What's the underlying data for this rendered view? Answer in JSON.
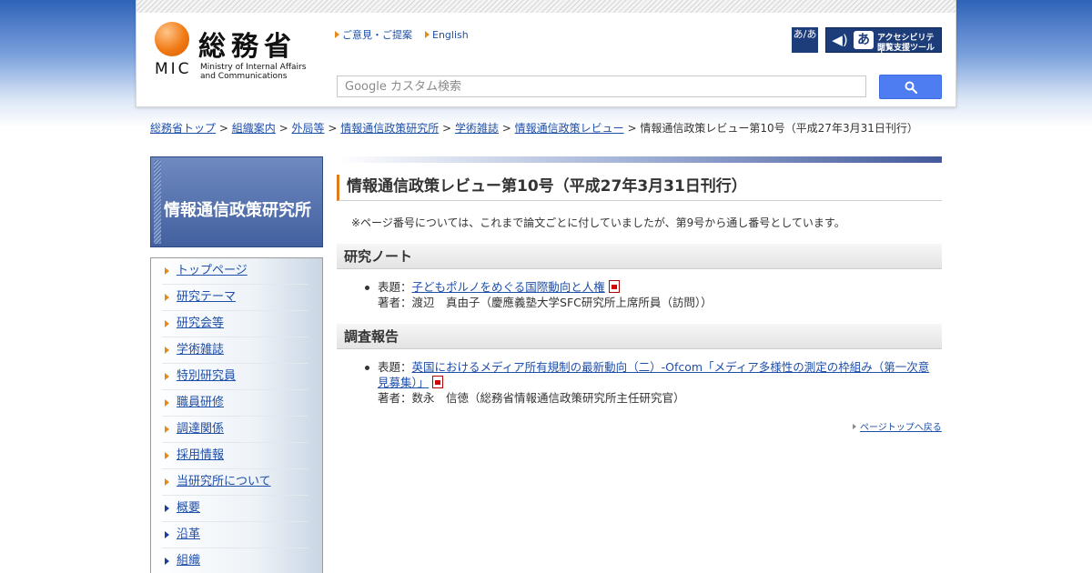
{
  "header": {
    "logo": {
      "kanji": "総務省",
      "abbr": "MIC",
      "english_line1": "Ministry of Internal Affairs",
      "english_line2": "and Communications"
    },
    "links": [
      {
        "label": "ご意見・ご提案"
      },
      {
        "label": "English"
      }
    ],
    "font_size_icon_text": "あ/あ",
    "a11y_tool": {
      "line1": "アクセシビリティ",
      "line2": "閲覧支援ツール"
    },
    "search": {
      "placeholder": "Google カスタム検索"
    },
    "colors": {
      "accent_orange": "#e88a1a",
      "navy": "#1d3d7a",
      "search_button": "#4d7df1"
    }
  },
  "breadcrumb": {
    "items": [
      {
        "label": "総務省トップ"
      },
      {
        "label": "組織案内"
      },
      {
        "label": "外局等"
      },
      {
        "label": "情報通信政策研究所"
      },
      {
        "label": "学術雑誌"
      },
      {
        "label": "情報通信政策レビュー"
      }
    ],
    "current": "情報通信政策レビュー第10号（平成27年3月31日刊行）",
    "separator": ">"
  },
  "sidebar": {
    "title": "情報通信政策研究所",
    "items": [
      {
        "label": "トップページ",
        "marker": "orange"
      },
      {
        "label": "研究テーマ",
        "marker": "orange"
      },
      {
        "label": "研究会等",
        "marker": "orange"
      },
      {
        "label": "学術雑誌",
        "marker": "orange"
      },
      {
        "label": "特別研究員",
        "marker": "orange"
      },
      {
        "label": "職員研修",
        "marker": "orange"
      },
      {
        "label": "調達関係",
        "marker": "orange"
      },
      {
        "label": "採用情報",
        "marker": "orange"
      },
      {
        "label": "当研究所について",
        "marker": "orange"
      },
      {
        "label": "概要",
        "marker": "blue"
      },
      {
        "label": "沿革",
        "marker": "blue"
      },
      {
        "label": "組織",
        "marker": "blue"
      }
    ]
  },
  "main": {
    "title": "情報通信政策レビュー第10号（平成27年3月31日刊行）",
    "note": "※ページ番号については、これまで論文ごとに付していましたが、第9号から通し番号としています。",
    "sections": [
      {
        "heading": "研究ノート",
        "entries": [
          {
            "title_label": "表題：",
            "title_link": "子どもポルノをめぐる国際動向と人権",
            "author_label": "著者：",
            "author": "渡辺　真由子（慶應義塾大学SFC研究所上席所員（訪問））"
          }
        ]
      },
      {
        "heading": "調査報告",
        "entries": [
          {
            "title_label": "表題：",
            "title_link": "英国におけるメディア所有規制の最新動向（二）-Ofcom「メディア多様性の測定の枠組み（第一次意見募集）」",
            "author_label": "著者：",
            "author": "数永　信徳（総務省情報通信政策研究所主任研究官）"
          }
        ]
      }
    ],
    "page_top": "ページトップへ戻る"
  }
}
